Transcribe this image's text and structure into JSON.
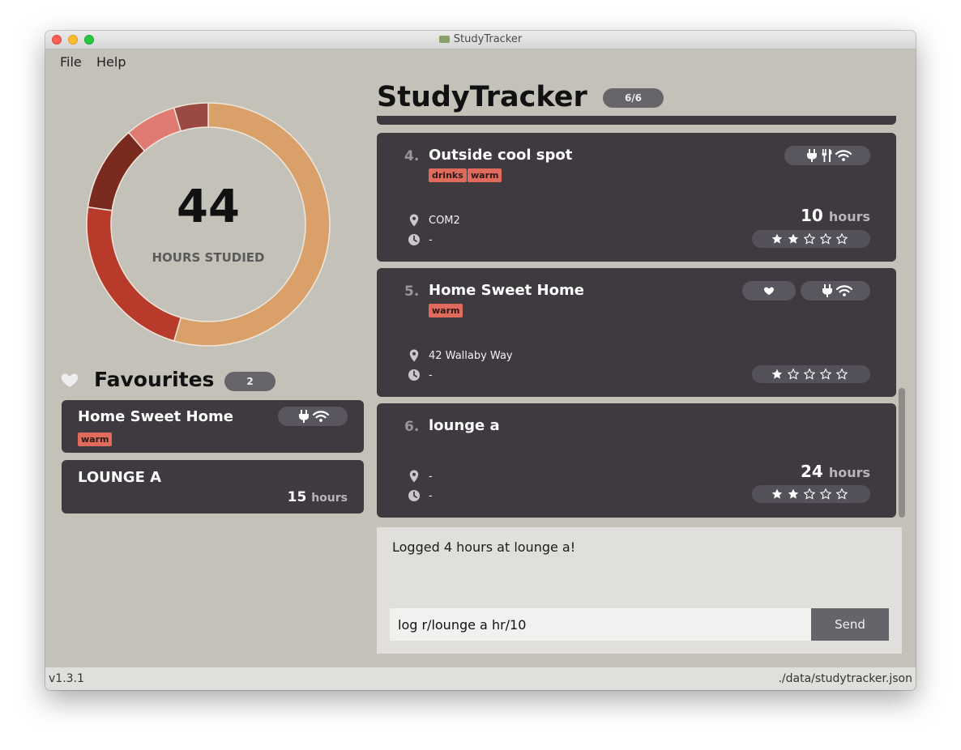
{
  "window": {
    "title": "StudyTracker"
  },
  "menu": {
    "file": "File",
    "help": "Help"
  },
  "summary": {
    "total_hours": "44",
    "total_label": "HOURS STUDIED",
    "segments": [
      {
        "value": 24,
        "color": "#d9a06a"
      },
      {
        "value": 10,
        "color": "#b83a2b"
      },
      {
        "value": 5,
        "color": "#7a2a1f"
      },
      {
        "value": 3,
        "color": "#e07b72"
      },
      {
        "value": 2,
        "color": "#9a4a42"
      }
    ]
  },
  "favourites": {
    "title": "Favourites",
    "count": "2",
    "items": [
      {
        "name": "Home Sweet Home",
        "tags": [
          "warm"
        ],
        "amenities": [
          "plug-icon",
          "wifi-icon"
        ]
      },
      {
        "name": "LOUNGE A",
        "hours": "15",
        "hours_unit": "hours"
      }
    ]
  },
  "main": {
    "title": "StudyTracker",
    "count_badge": "6/6",
    "locations": [
      {
        "index": "4.",
        "name": "Outside cool spot",
        "tags": [
          "drinks",
          "warm"
        ],
        "address": "COM2",
        "time": "-",
        "hours": "10",
        "hours_unit": "hours",
        "rating": 2,
        "amenities": [
          "plug-icon",
          "food-icon",
          "wifi-icon"
        ]
      },
      {
        "index": "5.",
        "name": "Home Sweet Home",
        "tags": [
          "warm"
        ],
        "address": "42 Wallaby Way",
        "time": "-",
        "rating": 1,
        "favourite": true,
        "amenities": [
          "plug-icon",
          "wifi-icon"
        ]
      },
      {
        "index": "6.",
        "name": "lounge a",
        "tags": [],
        "address": "-",
        "time": "-",
        "hours": "24",
        "hours_unit": "hours",
        "rating": 2
      }
    ]
  },
  "command": {
    "result": "Logged 4 hours at lounge a!",
    "input_value": "log r/lounge a hr/10",
    "send_label": "Send"
  },
  "status": {
    "version": "v1.3.1",
    "path": "./data/studytracker.json"
  }
}
